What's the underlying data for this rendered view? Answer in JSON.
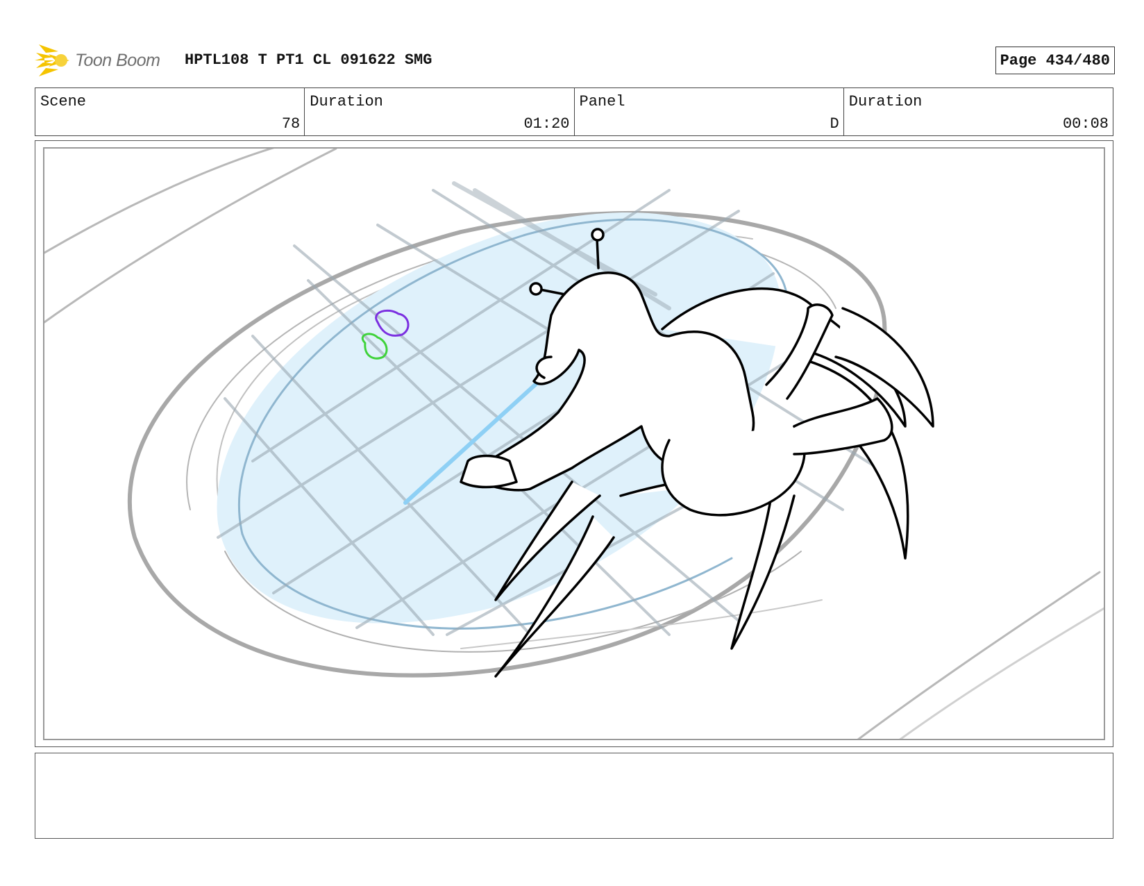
{
  "header": {
    "logo_text": "Toon Boom",
    "title": "HPTL108 T PT1 CL 091622 SMG",
    "page_label": "Page 434/480"
  },
  "info": {
    "scene_label": "Scene",
    "scene_value": "78",
    "scene_duration_label": "Duration",
    "scene_duration_value": "01:20",
    "panel_label": "Panel",
    "panel_value": "D",
    "panel_duration_label": "Duration",
    "panel_duration_value": "00:08"
  },
  "notes": {
    "text": ""
  },
  "colors": {
    "logo_star": "#f5c400",
    "logo_text": "#6e6e6e",
    "water": "#dff1fb",
    "water_line": "#8fb6cf",
    "grid_lines": "#9aa8b2",
    "sketch_gray": "#a0a0a0",
    "ink": "#000000",
    "purple_blob": "#7b2fe0",
    "green_blob": "#3fd23a",
    "light_ray": "#8ed0f5"
  }
}
